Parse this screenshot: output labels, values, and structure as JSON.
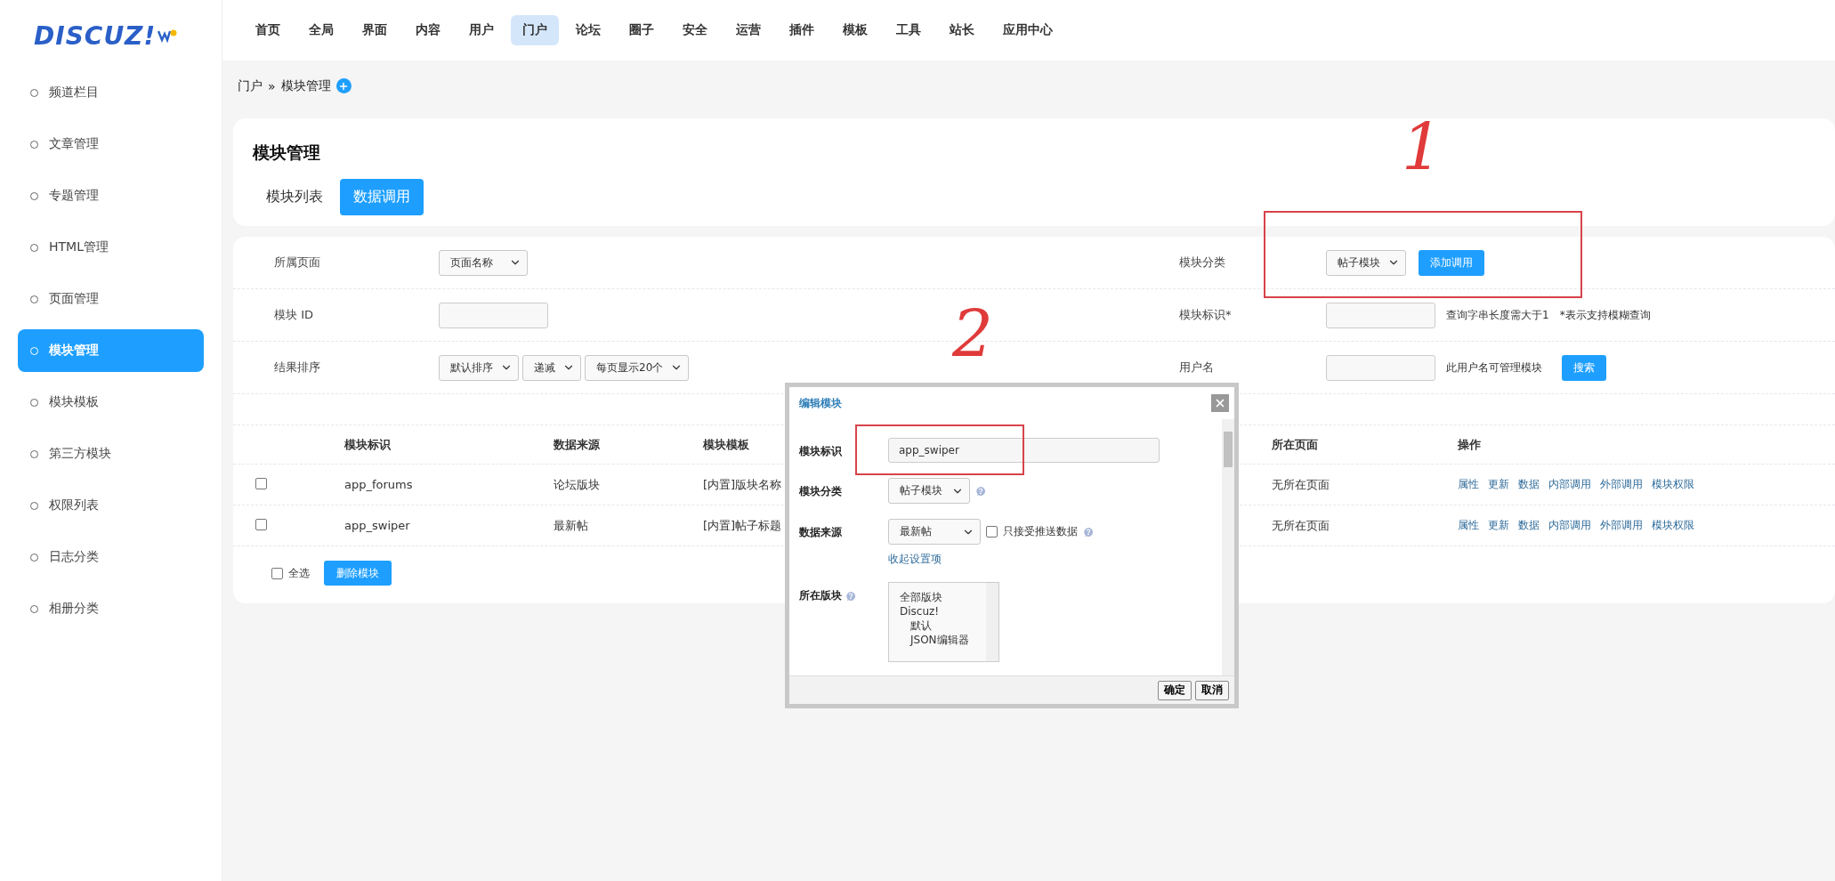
{
  "logo": {
    "text": "DISCUZ!"
  },
  "nav": [
    {
      "label": "首页",
      "selected": false
    },
    {
      "label": "全局",
      "selected": false
    },
    {
      "label": "界面",
      "selected": false
    },
    {
      "label": "内容",
      "selected": false
    },
    {
      "label": "用户",
      "selected": false
    },
    {
      "label": "门户",
      "selected": true
    },
    {
      "label": "论坛",
      "selected": false
    },
    {
      "label": "圈子",
      "selected": false
    },
    {
      "label": "安全",
      "selected": false
    },
    {
      "label": "运营",
      "selected": false
    },
    {
      "label": "插件",
      "selected": false
    },
    {
      "label": "模板",
      "selected": false
    },
    {
      "label": "工具",
      "selected": false
    },
    {
      "label": "站长",
      "selected": false
    },
    {
      "label": "应用中心",
      "selected": false
    }
  ],
  "sidebar": {
    "items": [
      {
        "label": "频道栏目",
        "selected": false
      },
      {
        "label": "文章管理",
        "selected": false
      },
      {
        "label": "专题管理",
        "selected": false
      },
      {
        "label": "HTML管理",
        "selected": false
      },
      {
        "label": "页面管理",
        "selected": false
      },
      {
        "label": "模块管理",
        "selected": true
      },
      {
        "label": "模块模板",
        "selected": false
      },
      {
        "label": "第三方模块",
        "selected": false
      },
      {
        "label": "权限列表",
        "selected": false
      },
      {
        "label": "日志分类",
        "selected": false
      },
      {
        "label": "相册分类",
        "selected": false
      }
    ]
  },
  "breadcrumb": {
    "items": [
      "门户",
      "模块管理"
    ],
    "separator": "»"
  },
  "page": {
    "title": "模块管理",
    "tabs": [
      {
        "label": "模块列表",
        "selected": false
      },
      {
        "label": "数据调用",
        "selected": true
      }
    ]
  },
  "filters": {
    "rows": [
      {
        "left": {
          "label": "所属页面",
          "controls": [
            {
              "kind": "select",
              "value": "页面名称"
            }
          ]
        },
        "right": {
          "label": "模块分类",
          "controls": [
            {
              "kind": "select",
              "value": "帖子模块"
            },
            {
              "kind": "button",
              "value": "添加调用"
            }
          ]
        }
      },
      {
        "left": {
          "label": "模块 ID",
          "controls": [
            {
              "kind": "input"
            }
          ]
        },
        "right": {
          "label": "模块标识*",
          "controls": [
            {
              "kind": "input"
            },
            {
              "kind": "note",
              "value": "查询字串长度需大于1"
            },
            {
              "kind": "note",
              "value": "*表示支持模糊查询"
            }
          ]
        }
      },
      {
        "left": {
          "label": "结果排序",
          "controls": [
            {
              "kind": "select",
              "value": "默认排序"
            },
            {
              "kind": "select",
              "value": "递减"
            },
            {
              "kind": "select",
              "value": "每页显示20个"
            }
          ]
        },
        "right": {
          "label": "用户名",
          "controls": [
            {
              "kind": "input"
            },
            {
              "kind": "note",
              "value": "此用户名可管理模块"
            },
            {
              "kind": "button",
              "value": "搜索"
            }
          ]
        }
      }
    ]
  },
  "table": {
    "columns": [
      "模块标识",
      "数据来源",
      "模块模板",
      "所在页面",
      "操作"
    ],
    "rows": [
      {
        "checked": false,
        "cells": [
          "app_forums",
          "论坛版块",
          "[内置]版块名称",
          "无所在页面"
        ],
        "actions": [
          "属性",
          "更新",
          "数据",
          "内部调用",
          "外部调用",
          "模块权限"
        ]
      },
      {
        "checked": false,
        "cells": [
          "app_swiper",
          "最新帖",
          "[内置]帖子标题",
          "无所在页面"
        ],
        "actions": [
          "属性",
          "更新",
          "数据",
          "内部调用",
          "外部调用",
          "模块权限"
        ]
      }
    ],
    "select_all": {
      "label": "全选",
      "checked": false
    },
    "delete_button": "删除模块"
  },
  "dialog": {
    "title": "编辑模块",
    "fields": [
      {
        "kind": "input",
        "label": "模块标识",
        "value": "app_swiper"
      },
      {
        "kind": "select",
        "label": "模块分类",
        "value": "帖子模块",
        "help": true
      },
      {
        "kind": "select",
        "label": "数据来源",
        "value": "最新帖",
        "checkbox": {
          "label": "只接受推送数据",
          "checked": false
        },
        "help": true,
        "link": "收起设置项"
      },
      {
        "kind": "listbox",
        "label": "所在版块",
        "help": true,
        "items": [
          {
            "label": "全部版块"
          },
          {
            "label": "Discuz!",
            "children": [
              {
                "label": "默认"
              },
              {
                "label": "JSON编辑器"
              }
            ]
          }
        ]
      }
    ],
    "buttons": [
      "确定",
      "取消"
    ]
  },
  "annotations": [
    {
      "text": "1"
    },
    {
      "text": "2"
    }
  ]
}
